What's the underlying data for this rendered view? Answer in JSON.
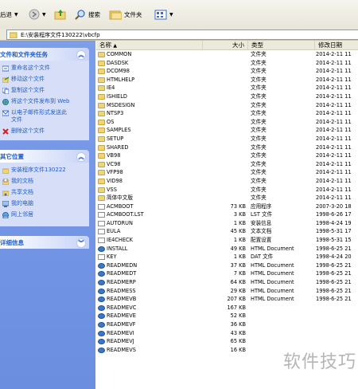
{
  "toolbar": {
    "back_label": "后退",
    "search_label": "搜索",
    "folders_label": "文件夹"
  },
  "address": {
    "path": "E:\\安装程序文件130222\\vbcfp"
  },
  "tasks_panel": {
    "title": "文件和文件夹任务",
    "items": [
      {
        "label": "重命名这个文件",
        "icon": "rename-icon"
      },
      {
        "label": "移动这个文件",
        "icon": "move-icon"
      },
      {
        "label": "复制这个文件",
        "icon": "copy-icon"
      },
      {
        "label": "将这个文件发布到 Web",
        "icon": "publish-web-icon"
      },
      {
        "label": "以电子邮件形式发送此",
        "label2": "文件",
        "icon": "email-icon"
      },
      {
        "label": "删除这个文件",
        "icon": "delete-icon"
      }
    ]
  },
  "places_panel": {
    "title": "其它位置",
    "items": [
      {
        "label": "安装程序文件130222",
        "icon": "folder-icon"
      },
      {
        "label": "我的文档",
        "icon": "documents-icon"
      },
      {
        "label": "共享文档",
        "icon": "shared-documents-icon"
      },
      {
        "label": "我的电脑",
        "icon": "computer-icon"
      },
      {
        "label": "网上邻居",
        "icon": "network-icon"
      }
    ]
  },
  "details_panel": {
    "title": "详细信息"
  },
  "columns": {
    "name": "名称",
    "size": "大小",
    "type": "类型",
    "date": "修改日期"
  },
  "files": [
    {
      "name": "COMMON",
      "size": "",
      "type": "文件夹",
      "date": "2014-2-11 11",
      "kind": "folder"
    },
    {
      "name": "DASDSK",
      "size": "",
      "type": "文件夹",
      "date": "2014-2-11 11",
      "kind": "folder"
    },
    {
      "name": "DCOM98",
      "size": "",
      "type": "文件夹",
      "date": "2014-2-11 11",
      "kind": "folder"
    },
    {
      "name": "HTMLHELP",
      "size": "",
      "type": "文件夹",
      "date": "2014-2-11 11",
      "kind": "folder"
    },
    {
      "name": "IE4",
      "size": "",
      "type": "文件夹",
      "date": "2014-2-11 11",
      "kind": "folder"
    },
    {
      "name": "ISHIELD",
      "size": "",
      "type": "文件夹",
      "date": "2014-2-11 11",
      "kind": "folder"
    },
    {
      "name": "MSDESIGN",
      "size": "",
      "type": "文件夹",
      "date": "2014-2-11 11",
      "kind": "folder"
    },
    {
      "name": "NTSP3",
      "size": "",
      "type": "文件夹",
      "date": "2014-2-11 11",
      "kind": "folder"
    },
    {
      "name": "OS",
      "size": "",
      "type": "文件夹",
      "date": "2014-2-11 11",
      "kind": "folder"
    },
    {
      "name": "SAMPLES",
      "size": "",
      "type": "文件夹",
      "date": "2014-2-11 11",
      "kind": "folder"
    },
    {
      "name": "SETUP",
      "size": "",
      "type": "文件夹",
      "date": "2014-2-11 11",
      "kind": "folder"
    },
    {
      "name": "SHARED",
      "size": "",
      "type": "文件夹",
      "date": "2014-2-11 11",
      "kind": "folder"
    },
    {
      "name": "VB98",
      "size": "",
      "type": "文件夹",
      "date": "2014-2-11 11",
      "kind": "folder"
    },
    {
      "name": "VC98",
      "size": "",
      "type": "文件夹",
      "date": "2014-2-11 11",
      "kind": "folder"
    },
    {
      "name": "VFP98",
      "size": "",
      "type": "文件夹",
      "date": "2014-2-11 11",
      "kind": "folder"
    },
    {
      "name": "VID98",
      "size": "",
      "type": "文件夹",
      "date": "2014-2-11 11",
      "kind": "folder"
    },
    {
      "name": "VSS",
      "size": "",
      "type": "文件夹",
      "date": "2014-2-11 11",
      "kind": "folder"
    },
    {
      "name": "简体中文版",
      "size": "",
      "type": "文件夹",
      "date": "2014-2-11 11",
      "kind": "folder"
    },
    {
      "name": "ACMBOOT",
      "size": "73 KB",
      "type": "应用程序",
      "date": "2007-3-20 18",
      "kind": "file"
    },
    {
      "name": "ACMBOOT.LST",
      "size": "3 KB",
      "type": "LST 文件",
      "date": "1998-6-26 17",
      "kind": "file"
    },
    {
      "name": "AUTORUN",
      "size": "1 KB",
      "type": "安装信息",
      "date": "1998-4-24 19",
      "kind": "file"
    },
    {
      "name": "EULA",
      "size": "45 KB",
      "type": "文本文档",
      "date": "1998-5-31 17",
      "kind": "file"
    },
    {
      "name": "IE4CHECK",
      "size": "1 KB",
      "type": "配置设置",
      "date": "1998-5-31 15",
      "kind": "file"
    },
    {
      "name": "INSTALL",
      "size": "49 KB",
      "type": "HTML Document",
      "date": "1998-6-25 21",
      "kind": "html"
    },
    {
      "name": "KEY",
      "size": "1 KB",
      "type": "DAT 文件",
      "date": "1998-4-24 20",
      "kind": "file"
    },
    {
      "name": "READMEDN",
      "size": "37 KB",
      "type": "HTML Document",
      "date": "1998-6-25 21",
      "kind": "html"
    },
    {
      "name": "READMEDT",
      "size": "7 KB",
      "type": "HTML Document",
      "date": "1998-6-25 21",
      "kind": "html"
    },
    {
      "name": "READMERP",
      "size": "64 KB",
      "type": "HTML Document",
      "date": "1998-6-25 21",
      "kind": "html"
    },
    {
      "name": "READMESS",
      "size": "29 KB",
      "type": "HTML Document",
      "date": "1998-6-25 21",
      "kind": "html"
    },
    {
      "name": "READMEVB",
      "size": "207 KB",
      "type": "HTML Document",
      "date": "1998-6-25 21",
      "kind": "html"
    },
    {
      "name": "READMEVC",
      "size": "167 KB",
      "type": "",
      "date": "",
      "kind": "html"
    },
    {
      "name": "READMEVE",
      "size": "52 KB",
      "type": "",
      "date": "",
      "kind": "html"
    },
    {
      "name": "READMEVF",
      "size": "36 KB",
      "type": "",
      "date": "",
      "kind": "html"
    },
    {
      "name": "READMEVI",
      "size": "43 KB",
      "type": "",
      "date": "",
      "kind": "html"
    },
    {
      "name": "READMEVJ",
      "size": "65 KB",
      "type": "",
      "date": "",
      "kind": "html"
    },
    {
      "name": "READMEVS",
      "size": "16 KB",
      "type": "",
      "date": "",
      "kind": "html"
    }
  ],
  "watermark": "软件技巧"
}
